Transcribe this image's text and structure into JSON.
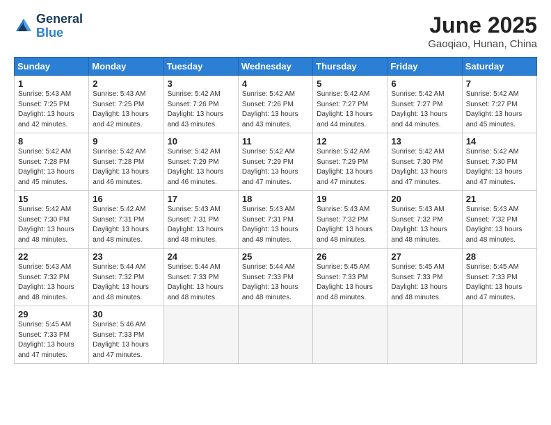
{
  "logo": {
    "line1": "General",
    "line2": "Blue"
  },
  "title": "June 2025",
  "subtitle": "Gaoqiao, Hunan, China",
  "weekdays": [
    "Sunday",
    "Monday",
    "Tuesday",
    "Wednesday",
    "Thursday",
    "Friday",
    "Saturday"
  ],
  "weeks": [
    [
      {
        "day": 1,
        "sunrise": "5:43 AM",
        "sunset": "7:25 PM",
        "daylight": "13 hours and 42 minutes."
      },
      {
        "day": 2,
        "sunrise": "5:43 AM",
        "sunset": "7:25 PM",
        "daylight": "13 hours and 42 minutes."
      },
      {
        "day": 3,
        "sunrise": "5:42 AM",
        "sunset": "7:26 PM",
        "daylight": "13 hours and 43 minutes."
      },
      {
        "day": 4,
        "sunrise": "5:42 AM",
        "sunset": "7:26 PM",
        "daylight": "13 hours and 43 minutes."
      },
      {
        "day": 5,
        "sunrise": "5:42 AM",
        "sunset": "7:27 PM",
        "daylight": "13 hours and 44 minutes."
      },
      {
        "day": 6,
        "sunrise": "5:42 AM",
        "sunset": "7:27 PM",
        "daylight": "13 hours and 44 minutes."
      },
      {
        "day": 7,
        "sunrise": "5:42 AM",
        "sunset": "7:27 PM",
        "daylight": "13 hours and 45 minutes."
      }
    ],
    [
      {
        "day": 8,
        "sunrise": "5:42 AM",
        "sunset": "7:28 PM",
        "daylight": "13 hours and 45 minutes."
      },
      {
        "day": 9,
        "sunrise": "5:42 AM",
        "sunset": "7:28 PM",
        "daylight": "13 hours and 46 minutes."
      },
      {
        "day": 10,
        "sunrise": "5:42 AM",
        "sunset": "7:29 PM",
        "daylight": "13 hours and 46 minutes."
      },
      {
        "day": 11,
        "sunrise": "5:42 AM",
        "sunset": "7:29 PM",
        "daylight": "13 hours and 47 minutes."
      },
      {
        "day": 12,
        "sunrise": "5:42 AM",
        "sunset": "7:29 PM",
        "daylight": "13 hours and 47 minutes."
      },
      {
        "day": 13,
        "sunrise": "5:42 AM",
        "sunset": "7:30 PM",
        "daylight": "13 hours and 47 minutes."
      },
      {
        "day": 14,
        "sunrise": "5:42 AM",
        "sunset": "7:30 PM",
        "daylight": "13 hours and 47 minutes."
      }
    ],
    [
      {
        "day": 15,
        "sunrise": "5:42 AM",
        "sunset": "7:30 PM",
        "daylight": "13 hours and 48 minutes."
      },
      {
        "day": 16,
        "sunrise": "5:42 AM",
        "sunset": "7:31 PM",
        "daylight": "13 hours and 48 minutes."
      },
      {
        "day": 17,
        "sunrise": "5:43 AM",
        "sunset": "7:31 PM",
        "daylight": "13 hours and 48 minutes."
      },
      {
        "day": 18,
        "sunrise": "5:43 AM",
        "sunset": "7:31 PM",
        "daylight": "13 hours and 48 minutes."
      },
      {
        "day": 19,
        "sunrise": "5:43 AM",
        "sunset": "7:32 PM",
        "daylight": "13 hours and 48 minutes."
      },
      {
        "day": 20,
        "sunrise": "5:43 AM",
        "sunset": "7:32 PM",
        "daylight": "13 hours and 48 minutes."
      },
      {
        "day": 21,
        "sunrise": "5:43 AM",
        "sunset": "7:32 PM",
        "daylight": "13 hours and 48 minutes."
      }
    ],
    [
      {
        "day": 22,
        "sunrise": "5:43 AM",
        "sunset": "7:32 PM",
        "daylight": "13 hours and 48 minutes."
      },
      {
        "day": 23,
        "sunrise": "5:44 AM",
        "sunset": "7:32 PM",
        "daylight": "13 hours and 48 minutes."
      },
      {
        "day": 24,
        "sunrise": "5:44 AM",
        "sunset": "7:33 PM",
        "daylight": "13 hours and 48 minutes."
      },
      {
        "day": 25,
        "sunrise": "5:44 AM",
        "sunset": "7:33 PM",
        "daylight": "13 hours and 48 minutes."
      },
      {
        "day": 26,
        "sunrise": "5:45 AM",
        "sunset": "7:33 PM",
        "daylight": "13 hours and 48 minutes."
      },
      {
        "day": 27,
        "sunrise": "5:45 AM",
        "sunset": "7:33 PM",
        "daylight": "13 hours and 48 minutes."
      },
      {
        "day": 28,
        "sunrise": "5:45 AM",
        "sunset": "7:33 PM",
        "daylight": "13 hours and 47 minutes."
      }
    ],
    [
      {
        "day": 29,
        "sunrise": "5:45 AM",
        "sunset": "7:33 PM",
        "daylight": "13 hours and 47 minutes."
      },
      {
        "day": 30,
        "sunrise": "5:46 AM",
        "sunset": "7:33 PM",
        "daylight": "13 hours and 47 minutes."
      },
      null,
      null,
      null,
      null,
      null
    ]
  ]
}
